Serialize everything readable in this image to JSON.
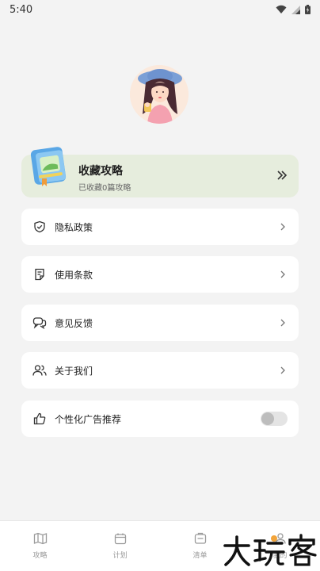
{
  "status_bar": {
    "time": "5:40",
    "icons": [
      "wifi-icon",
      "signal-icon",
      "battery-icon"
    ]
  },
  "profile": {
    "avatar": "avatar-illustration"
  },
  "favorites": {
    "title": "收藏攻略",
    "subtitle": "已收藏0篇攻略",
    "icon": "book-icon",
    "arrow_icon": "double-chevron-right-icon"
  },
  "menu": [
    {
      "label": "隐私政策",
      "icon": "shield-check-icon"
    },
    {
      "label": "使用条款",
      "icon": "document-icon"
    },
    {
      "label": "意见反馈",
      "icon": "chat-icon"
    },
    {
      "label": "关于我们",
      "icon": "users-icon"
    }
  ],
  "ad_setting": {
    "label": "个性化广告推荐",
    "icon": "thumbs-up-icon",
    "enabled": false
  },
  "tabs": [
    {
      "label": "攻略",
      "icon": "map-icon"
    },
    {
      "label": "计划",
      "icon": "calendar-icon"
    },
    {
      "label": "清单",
      "icon": "checklist-icon"
    },
    {
      "label": "我的",
      "icon": "profile-icon"
    }
  ],
  "watermark": {
    "text": "大玩客"
  },
  "colors": {
    "background": "#f3f3f3",
    "card": "#ffffff",
    "favorites_card": "#e6eddd",
    "tab_inactive": "#9a9a9a",
    "accent_orange": "#f2a43a"
  }
}
